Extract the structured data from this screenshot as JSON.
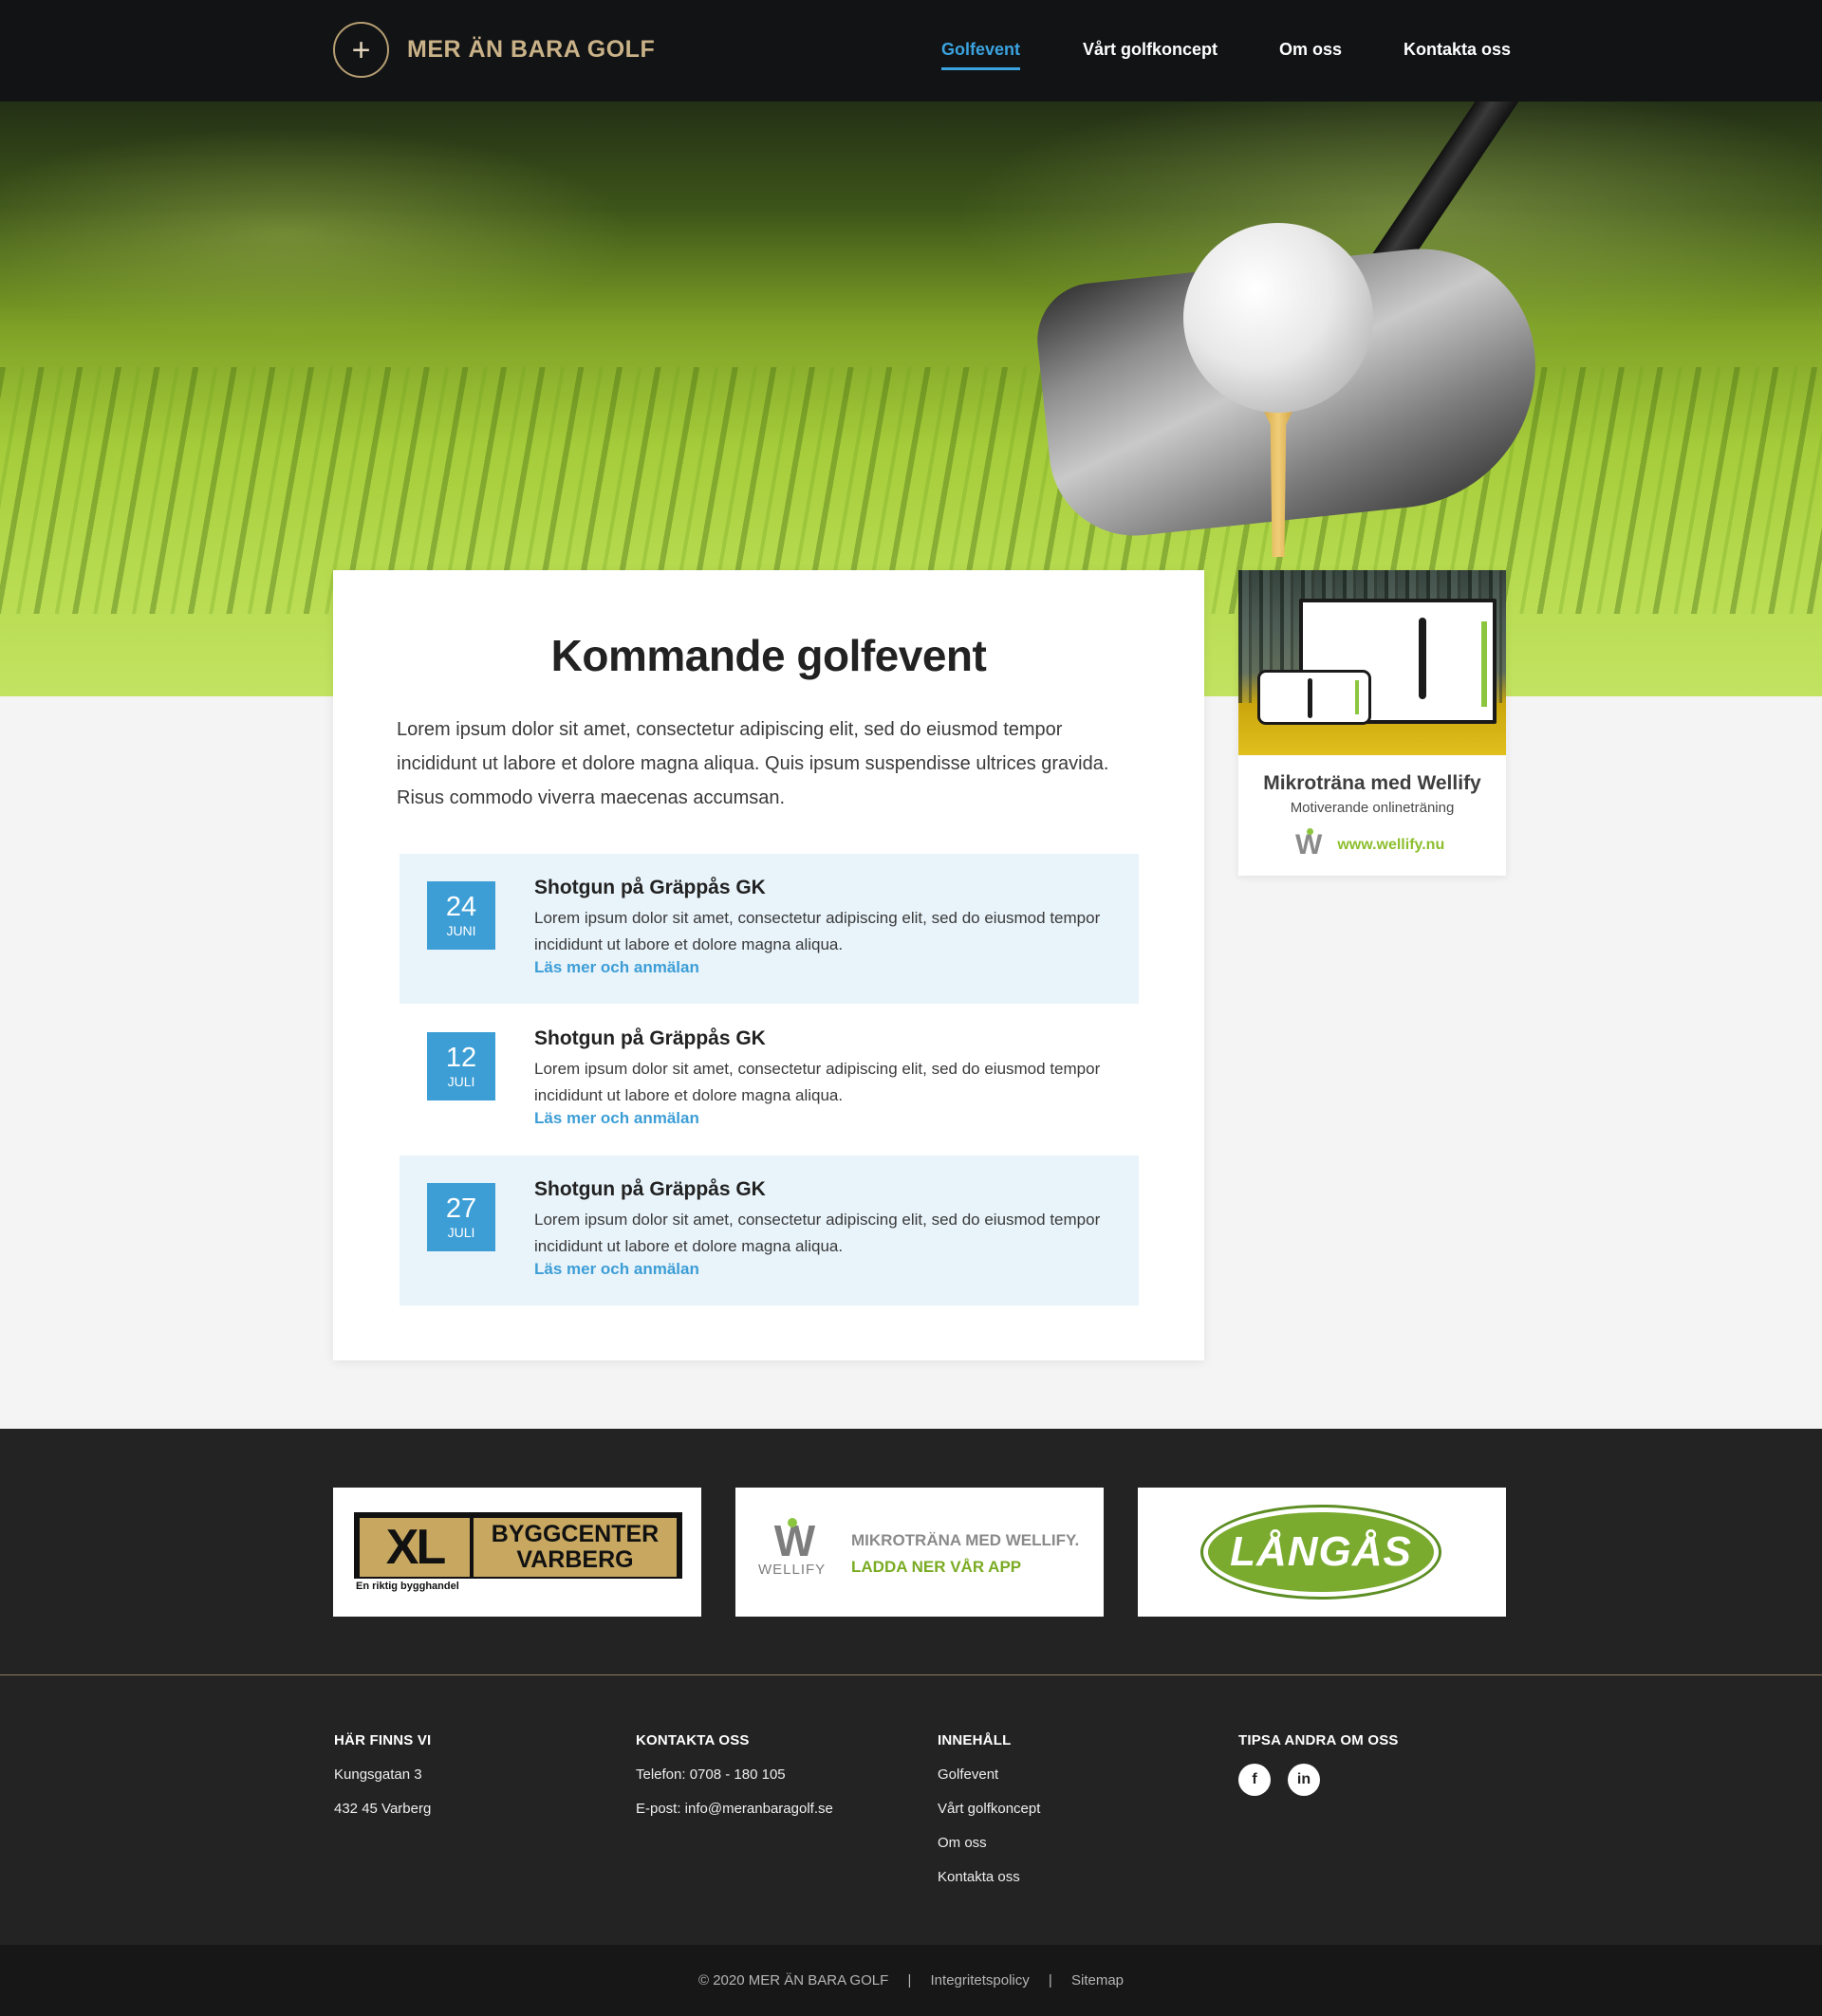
{
  "header": {
    "logo_symbol": "+",
    "logo_text": "MER ÄN BARA GOLF",
    "nav": [
      {
        "label": "Golfevent",
        "active": true
      },
      {
        "label": "Vårt golfkoncept",
        "active": false
      },
      {
        "label": "Om oss",
        "active": false
      },
      {
        "label": "Kontakta oss",
        "active": false
      }
    ]
  },
  "main": {
    "title": "Kommande golfevent",
    "intro": "Lorem ipsum dolor sit amet, consectetur adipiscing elit, sed do eiusmod tempor incididunt ut labore et dolore magna aliqua. Quis ipsum suspendisse ultrices gravida. Risus commodo viverra maecenas accumsan.",
    "events": [
      {
        "day": "24",
        "month": "JUNI",
        "title": "Shotgun på Gräppås GK",
        "description": "Lorem ipsum dolor sit amet, consectetur adipiscing elit, sed do eiusmod tempor incididunt ut labore et dolore magna aliqua.",
        "link": "Läs mer och anmälan"
      },
      {
        "day": "12",
        "month": "JULI",
        "title": "Shotgun på Gräppås GK",
        "description": "Lorem ipsum dolor sit amet, consectetur adipiscing elit, sed do eiusmod tempor incididunt ut labore et dolore magna aliqua.",
        "link": "Läs mer och anmälan"
      },
      {
        "day": "27",
        "month": "JULI",
        "title": "Shotgun på Gräppås GK",
        "description": "Lorem ipsum dolor sit amet, consectetur adipiscing elit, sed do eiusmod tempor incididunt ut labore et dolore magna aliqua.",
        "link": "Läs mer och anmälan"
      }
    ]
  },
  "sidebar_ad": {
    "title": "Mikroträna med Wellify",
    "subtitle": "Motiverande onlineträning",
    "logo_letter": "W",
    "url": "www.wellify.nu"
  },
  "partners": {
    "xl": {
      "left": "XL",
      "right_line1": "BYGGCENTER",
      "right_line2": "VARBERG",
      "tagline": "En riktig bygghandel"
    },
    "wellify": {
      "mark": "W",
      "name": "WELLIFY",
      "line1": "MIKROTRÄNA MED WELLIFY.",
      "line2": "LADDA NER VÅR APP"
    },
    "langas": {
      "name": "LÅNGÅS"
    }
  },
  "footer": {
    "address": {
      "heading": "HÄR FINNS VI",
      "line1": "Kungsgatan 3",
      "line2": "432 45 Varberg"
    },
    "contact": {
      "heading": "KONTAKTA OSS",
      "phone": "Telefon: 0708 - 180 105",
      "email": "E-post: info@meranbaragolf.se"
    },
    "content": {
      "heading": "INNEHÅLL",
      "links": [
        "Golfevent",
        "Vårt golfkoncept",
        "Om oss",
        "Kontakta oss"
      ]
    },
    "share": {
      "heading": "TIPSA ANDRA OM OSS",
      "facebook": "f",
      "linkedin": "in"
    }
  },
  "bottom": {
    "copyright": "© 2020 MER ÄN BARA GOLF",
    "separator": "|",
    "privacy": "Integritetspolicy",
    "sitemap": "Sitemap"
  },
  "colors": {
    "accent": "#3d9ed6",
    "header_bg": "#121314",
    "gold": "#c9b288",
    "green": "#8cbe2e",
    "footer_bg": "#232323"
  }
}
